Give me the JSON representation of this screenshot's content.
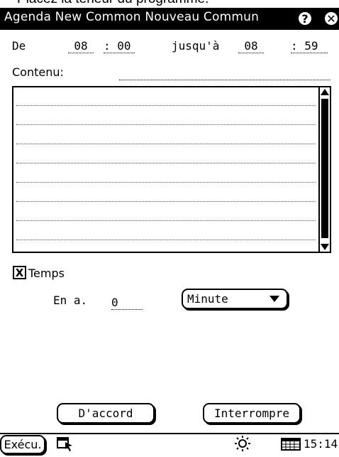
{
  "hint": "Placez la teneur du programme.",
  "window": {
    "title": "Agenda New Common Nouveau Commun",
    "help_icon": "question-circle-icon",
    "close_icon": "close-circle-icon"
  },
  "time": {
    "from_label": "De",
    "from_hour": "08",
    "from_min": ": 00",
    "until_label": "jusqu'à",
    "until_hour": "08",
    "until_min": ": 59"
  },
  "content": {
    "label": "Contenu:",
    "value": ""
  },
  "alarm": {
    "checkbox_mark": "X",
    "checked": true,
    "label": "Temps",
    "advance_label": "En a.",
    "advance_value": "0",
    "unit_selected": "Minute"
  },
  "buttons": {
    "ok": "D'accord",
    "cancel": "Interrompre"
  },
  "taskbar": {
    "exec_label": "Exécu.",
    "clock": "15:14"
  }
}
